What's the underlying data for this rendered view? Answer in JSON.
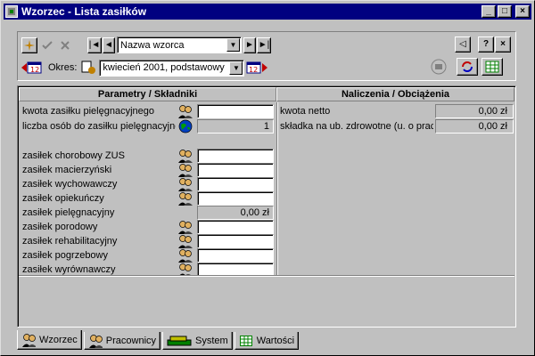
{
  "window": {
    "title": "Wzorzec - Lista zasiłków",
    "controls": {
      "minimize": "_",
      "maximize": "□",
      "close": "×"
    }
  },
  "toolbar": {
    "new_icon": "sparkle-icon",
    "confirm_icon": "check-icon",
    "cancel_icon": "x-icon",
    "nav_first": "|◄",
    "nav_prev": "◄",
    "name_combo_value": "Nazwa wzorca",
    "nav_next": "►",
    "nav_last": "►|",
    "back_label": "◁",
    "help_label": "?",
    "close_label": "×",
    "okres_label": "Okres:",
    "okres_value": "kwiecień 2001, podstawowy"
  },
  "panel": {
    "left_header": "Parametry / Składniki",
    "right_header": "Naliczenia / Obciążenia",
    "params": [
      {
        "label": "kwota zasiłku pielęgnacyjnego",
        "value": "",
        "style": "white",
        "icon": "people-icon"
      },
      {
        "label": "liczba osób do zasiłku pielęgnacyjnego",
        "value": "1",
        "style": "grey",
        "icon": "globe-icon"
      }
    ],
    "items": [
      {
        "label": "zasiłek chorobowy ZUS",
        "value": "",
        "style": "white",
        "icon": "people-icon"
      },
      {
        "label": "zasiłek macierzyński",
        "value": "",
        "style": "white",
        "icon": "people-icon"
      },
      {
        "label": "zasiłek wychowawczy",
        "value": "",
        "style": "white",
        "icon": "people-icon"
      },
      {
        "label": "zasiłek opiekuńczy",
        "value": "",
        "style": "white",
        "icon": "people-icon"
      },
      {
        "label": "zasiłek pielęgnacyjny",
        "value": "0,00 zł",
        "style": "grey",
        "icon": ""
      },
      {
        "label": "zasiłek porodowy",
        "value": "",
        "style": "white",
        "icon": "people-icon"
      },
      {
        "label": "zasiłek rehabilitacyjny",
        "value": "",
        "style": "white",
        "icon": "people-icon"
      },
      {
        "label": "zasiłek pogrzebowy",
        "value": "",
        "style": "white",
        "icon": "people-icon"
      },
      {
        "label": "zasiłek wyrównawczy",
        "value": "",
        "style": "white",
        "icon": "people-icon"
      }
    ],
    "charges": [
      {
        "label": "kwota netto",
        "value": "0,00 zł"
      },
      {
        "label": "składka na ub. zdrowotne (u. o pracę)",
        "value": "0,00 zł"
      }
    ]
  },
  "tabs": [
    {
      "label": "Wzorzec",
      "icon": "people-icon",
      "active": true
    },
    {
      "label": "Pracownicy",
      "icon": "people-icon",
      "active": false
    },
    {
      "label": "System",
      "icon": "books-icon",
      "active": false
    },
    {
      "label": "Wartości",
      "icon": "table-icon",
      "active": false
    }
  ],
  "colors": {
    "titlebar": "#000080",
    "face": "#c0c0c0"
  }
}
